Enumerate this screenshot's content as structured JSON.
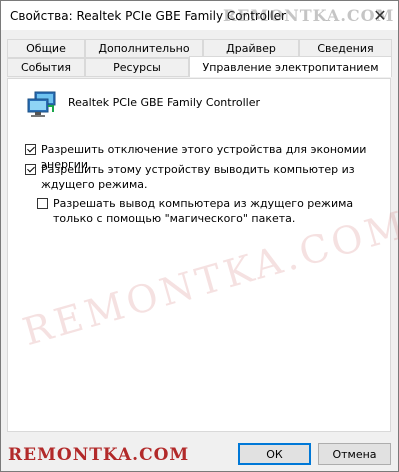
{
  "window": {
    "title": "Свойства: Realtek PCIe GBE Family Controller",
    "close_glyph": "✕"
  },
  "watermark": "REMONTKA.COM",
  "watermark_mid": "REMONTKA.COM",
  "tabs": {
    "row1": [
      "Общие",
      "Дополнительно",
      "Драйвер",
      "Сведения"
    ],
    "row2": [
      "События",
      "Ресурсы",
      "Управление электропитанием"
    ],
    "active": "Управление электропитанием"
  },
  "device": {
    "name": "Realtek PCIe GBE Family Controller",
    "icon": "network-adapter-icon"
  },
  "options": [
    {
      "label": "Разрешить отключение этого устройства для экономии энергии.",
      "checked": true
    },
    {
      "label": "Разрешить этому устройству выводить компьютер из ждущего режима.",
      "checked": true
    },
    {
      "label": "Разрешать вывод компьютера из ждущего режима только с помощью \"магического\" пакета.",
      "checked": false
    }
  ],
  "buttons": {
    "ok": "ОК",
    "cancel": "Отмена"
  },
  "colors": {
    "accent": "#0078d7",
    "watermark_red": "#b22a2a"
  }
}
